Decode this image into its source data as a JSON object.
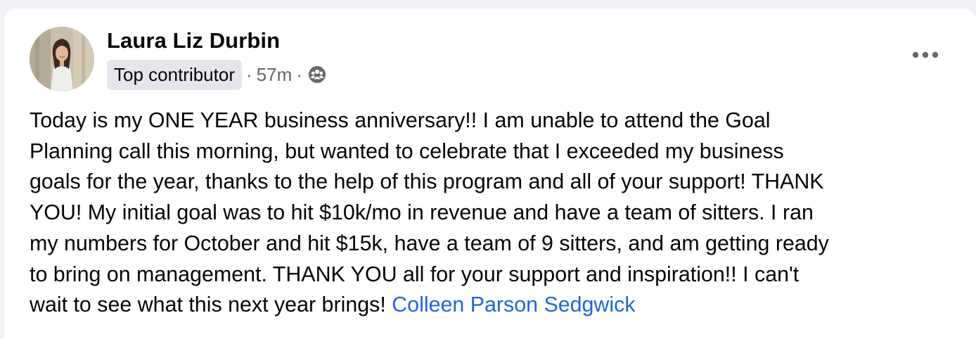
{
  "post": {
    "author": {
      "name": "Laura Liz Durbin",
      "badge": "Top contributor",
      "avatar_icon": "profile-photo"
    },
    "meta": {
      "separator": "·",
      "time": "57m",
      "audience_icon": "group-members-icon"
    },
    "more_icon": "more-horizontal-icon",
    "body_lines": [
      "Today is my ONE YEAR business anniversary!! I am unable to attend the Goal",
      "Planning call this morning, but wanted to celebrate that I exceeded my business",
      "goals for the year, thanks to the help of this program and all of your support! THANK",
      "YOU! My initial goal was to hit $10k/mo in revenue and have a team of sitters. I ran",
      "my numbers for October and hit $15k, have a team of 9 sitters, and am getting ready",
      "to bring on management. THANK YOU all for your support and inspiration!! I can't",
      "wait to see what this next year brings!"
    ],
    "mention": "Colleen Parson Sedgwick"
  },
  "colors": {
    "page_background": "#f0f2f5",
    "card_background": "#ffffff",
    "primary_text": "#050505",
    "secondary_text": "#65676b",
    "badge_background": "#e4e6eb",
    "mention_link": "#2166d9"
  }
}
